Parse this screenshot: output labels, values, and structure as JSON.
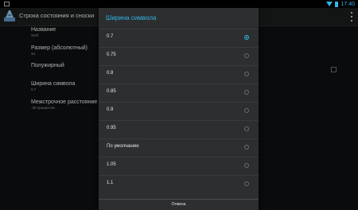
{
  "status_bar": {
    "time": "17:40"
  },
  "action_bar": {
    "title": "Строка состояния и сноски",
    "overflow_icon": "overflow-menu-icon"
  },
  "preferences": [
    {
      "title": "Название",
      "summary": "Serif"
    },
    {
      "title": "Размер (абсолютный)",
      "summary": "34"
    },
    {
      "title": "Полужирный",
      "summary": ""
    },
    {
      "title": "Ширина символа",
      "summary": "0.7"
    },
    {
      "title": "Межстрочное расстояние",
      "summary": "-30 процентов"
    }
  ],
  "dialog": {
    "title": "Ширина символа",
    "options": [
      "0.7",
      "0.75",
      "0.8",
      "0.85",
      "0.9",
      "0.95",
      "По умолчанию",
      "1.05",
      "1.1"
    ],
    "selected": "0.7",
    "cancel_label": "Отмена"
  },
  "colors": {
    "accent": "#33b5e5",
    "dialog_bg": "#2d2e2f",
    "background": "#0d0f10"
  }
}
